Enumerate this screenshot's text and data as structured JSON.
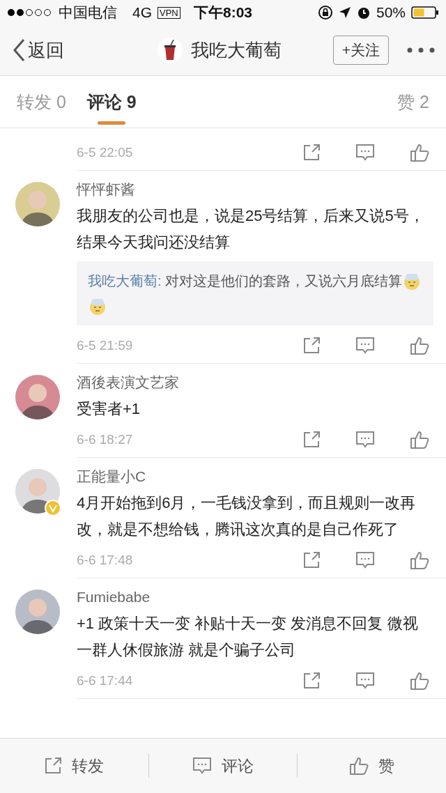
{
  "status_bar": {
    "carrier": "中国电信",
    "network": "4G",
    "vpn": "VPN",
    "time": "下午8:03",
    "battery": "50%"
  },
  "nav": {
    "back": "返回",
    "title": "我吃大葡萄",
    "follow": "+关注"
  },
  "tabs": [
    {
      "label": "转发 0",
      "selected": false
    },
    {
      "label": "评论 9",
      "selected": true
    },
    {
      "label": "赞 2",
      "selected": false
    }
  ],
  "comments": [
    {
      "time": "6-5 22:05"
    },
    {
      "name": "怦怦虾酱",
      "text": "我朋友的公司也是，说是25号结算，后来又说5号，结果今天我问还没结算",
      "reply": {
        "author": "我吃大葡萄:",
        "text": " 对对这是他们的套路，又说六月底结算",
        "emojis": [
          {
            "kind": "sweat"
          },
          {
            "kind": "sweat"
          }
        ]
      },
      "time": "6-5 21:59"
    },
    {
      "name": "酒後表演文艺家",
      "text": "受害者+1",
      "time": "6-6 18:27"
    },
    {
      "name": "正能量小C",
      "verified": true,
      "text": "4月开始拖到6月，一毛钱没拿到，而且规则一改再改，就是不想给钱，腾讯这次真的是自己作死了",
      "time": "6-6 17:48"
    },
    {
      "name": "Fumiebabe",
      "text": "+1 政策十天一变 补贴十天一变 发消息不回复 微视一群人休假旅游 就是个骗子公司",
      "time": "6-6 17:44"
    }
  ],
  "bottom_bar": [
    "转发",
    "评论",
    "赞"
  ]
}
